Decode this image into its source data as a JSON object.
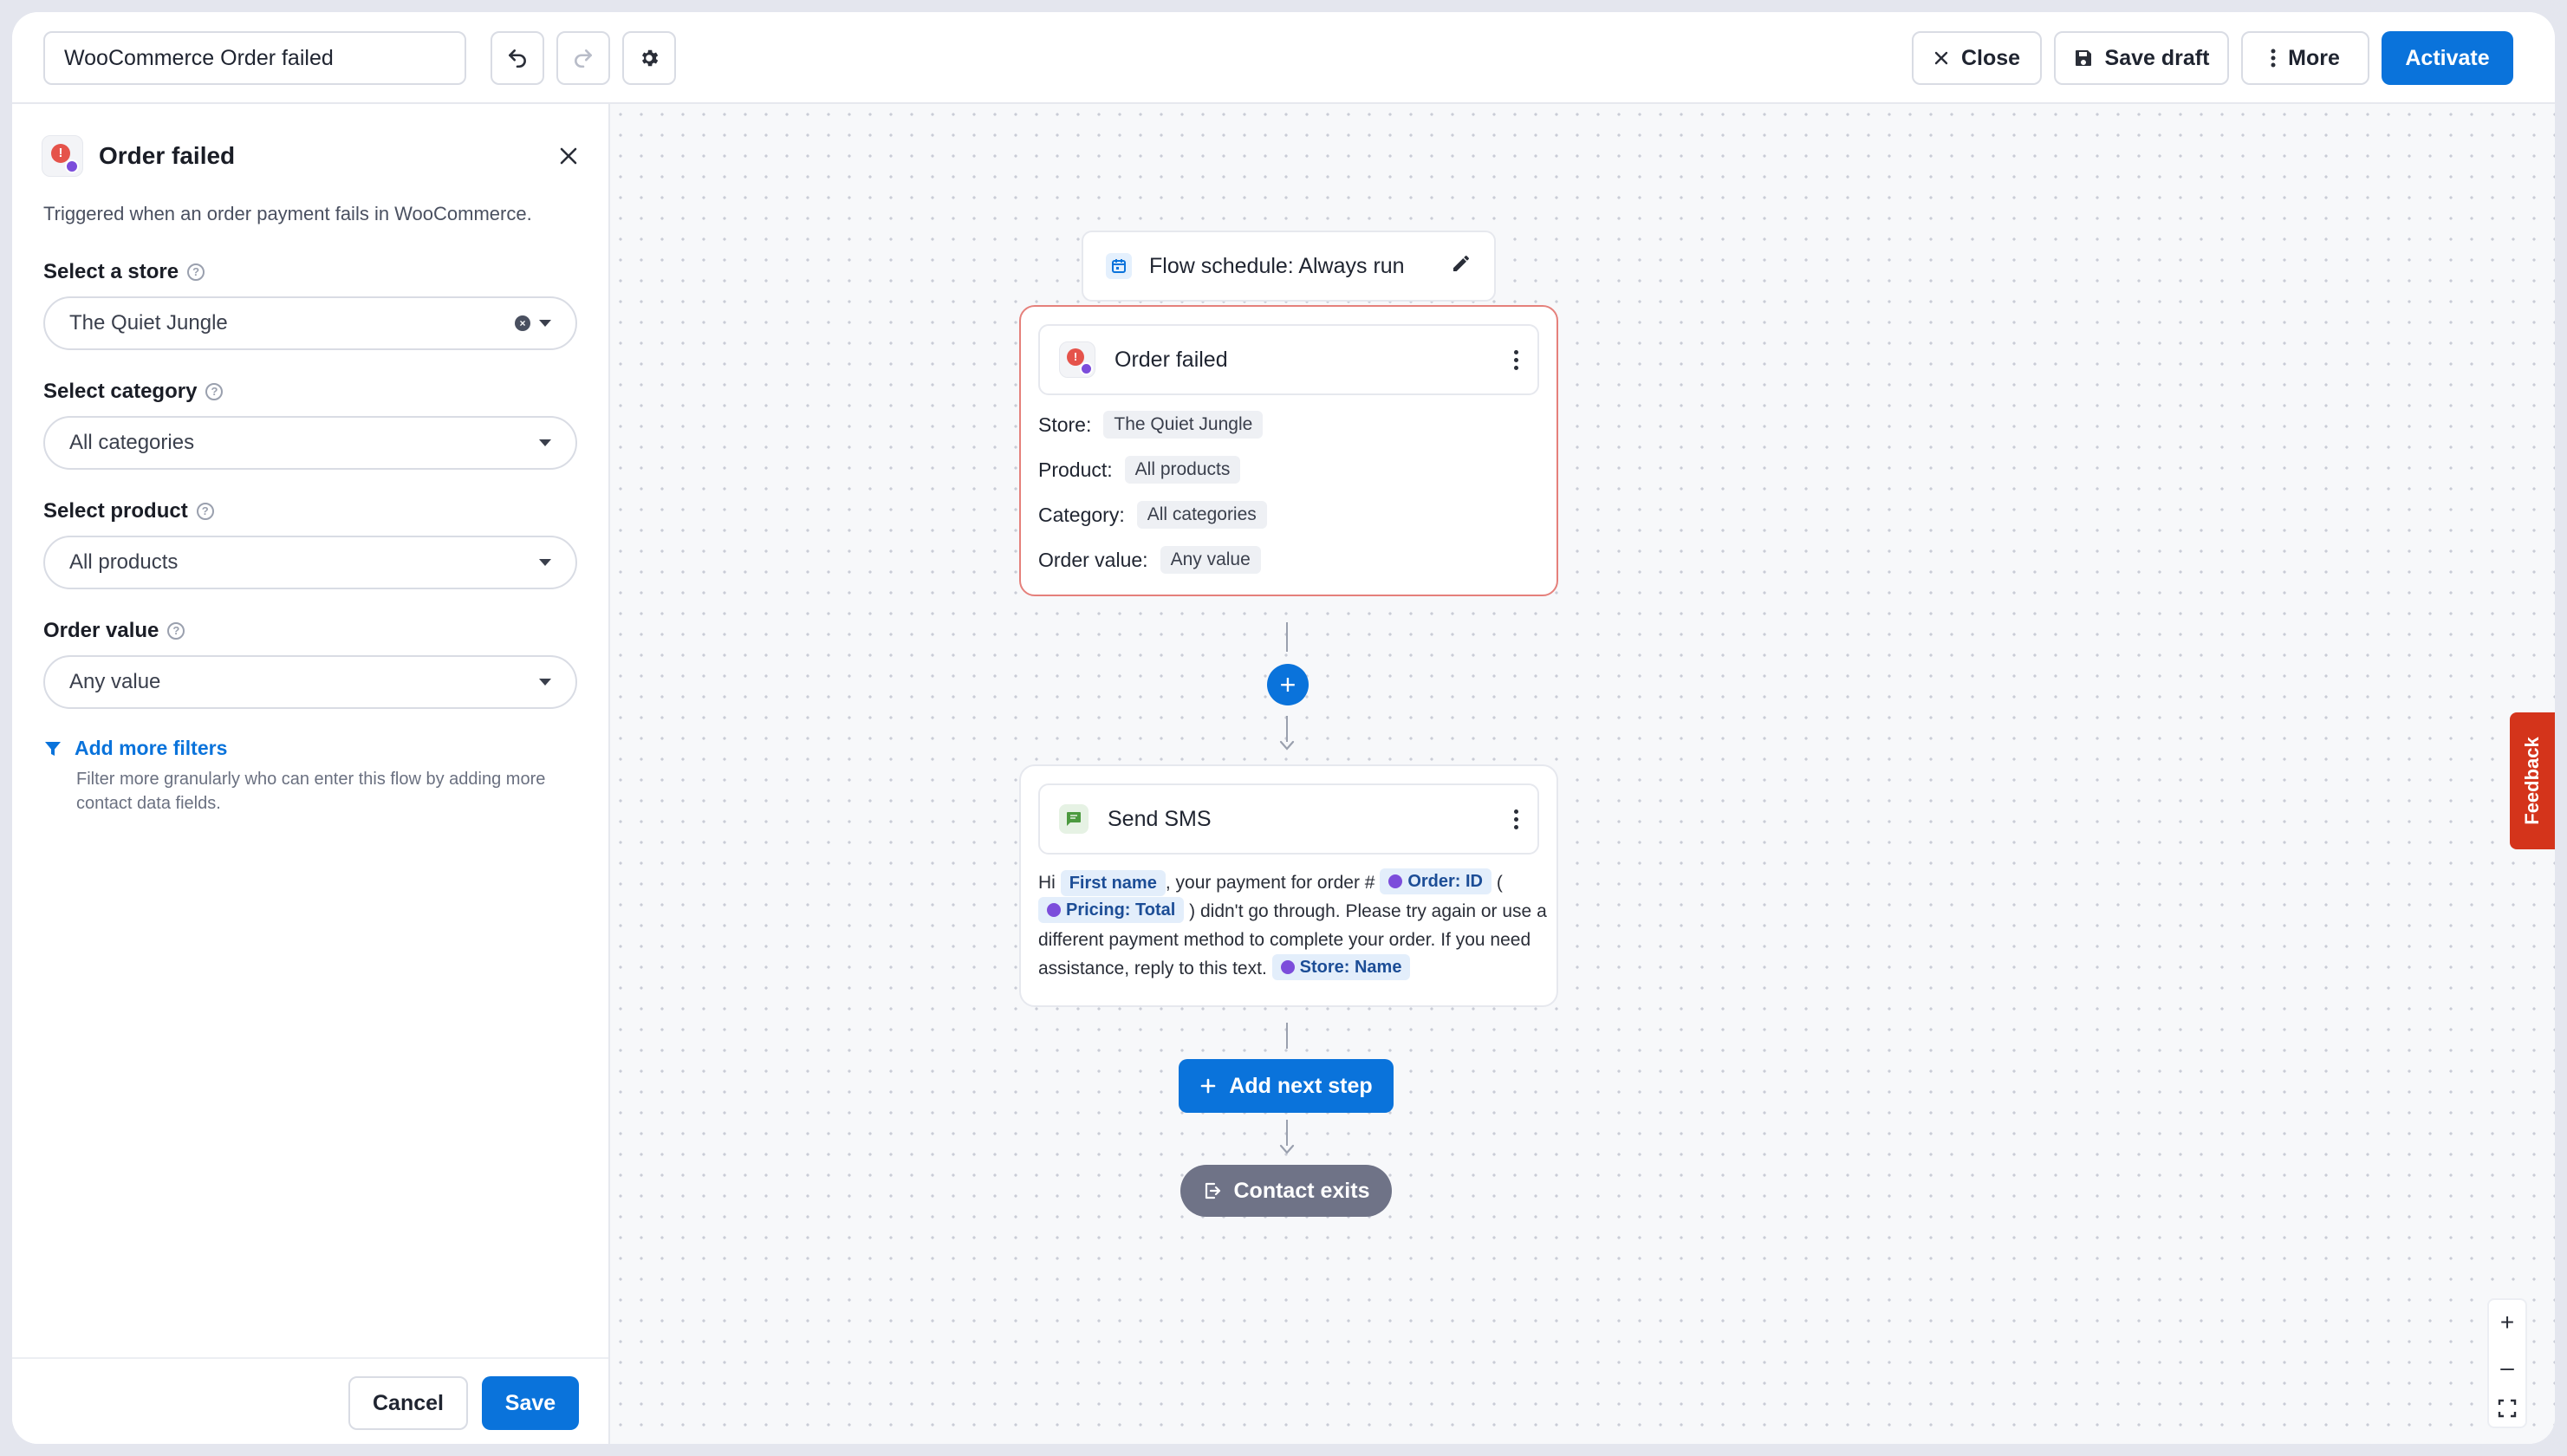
{
  "topbar": {
    "flow_name": "WooCommerce Order failed",
    "close_label": "Close",
    "save_draft_label": "Save draft",
    "more_label": "More",
    "activate_label": "Activate"
  },
  "panel": {
    "title": "Order failed",
    "description": "Triggered when an order payment fails in WooCommerce.",
    "fields": {
      "store": {
        "label": "Select a store",
        "value": "The Quiet Jungle"
      },
      "category": {
        "label": "Select category",
        "value": "All categories"
      },
      "product": {
        "label": "Select product",
        "value": "All products"
      },
      "order_value": {
        "label": "Order value",
        "value": "Any value"
      }
    },
    "filters": {
      "link": "Add more filters",
      "description": "Filter more granularly who can enter this flow by adding more contact data fields."
    },
    "cancel_label": "Cancel",
    "save_label": "Save"
  },
  "canvas": {
    "schedule": "Flow schedule: Always run",
    "trigger": {
      "title": "Order failed",
      "rows": [
        {
          "key": "Store:",
          "value": "The Quiet Jungle"
        },
        {
          "key": "Product:",
          "value": "All products"
        },
        {
          "key": "Category:",
          "value": "All categories"
        },
        {
          "key": "Order value:",
          "value": "Any value"
        }
      ]
    },
    "sms": {
      "title": "Send SMS",
      "text_1": "Hi",
      "token_first_name": "First name",
      "text_2": ", your payment for order #",
      "token_order_id": "Order: ID",
      "text_3": "(",
      "token_pricing_total": "Pricing: Total",
      "text_4": ") didn't go through. Please try again or use a different payment method to complete your order. If you need assistance, reply to this text.",
      "token_store_name": "Store: Name"
    },
    "add_next_step_label": "Add next step",
    "contact_exits_label": "Contact exits",
    "feedback_label": "Feedback"
  },
  "colors": {
    "primary": "#0a73db",
    "trigger_border": "#e5807b",
    "feedback": "#d4341b",
    "exit_pill": "#6f7387"
  }
}
